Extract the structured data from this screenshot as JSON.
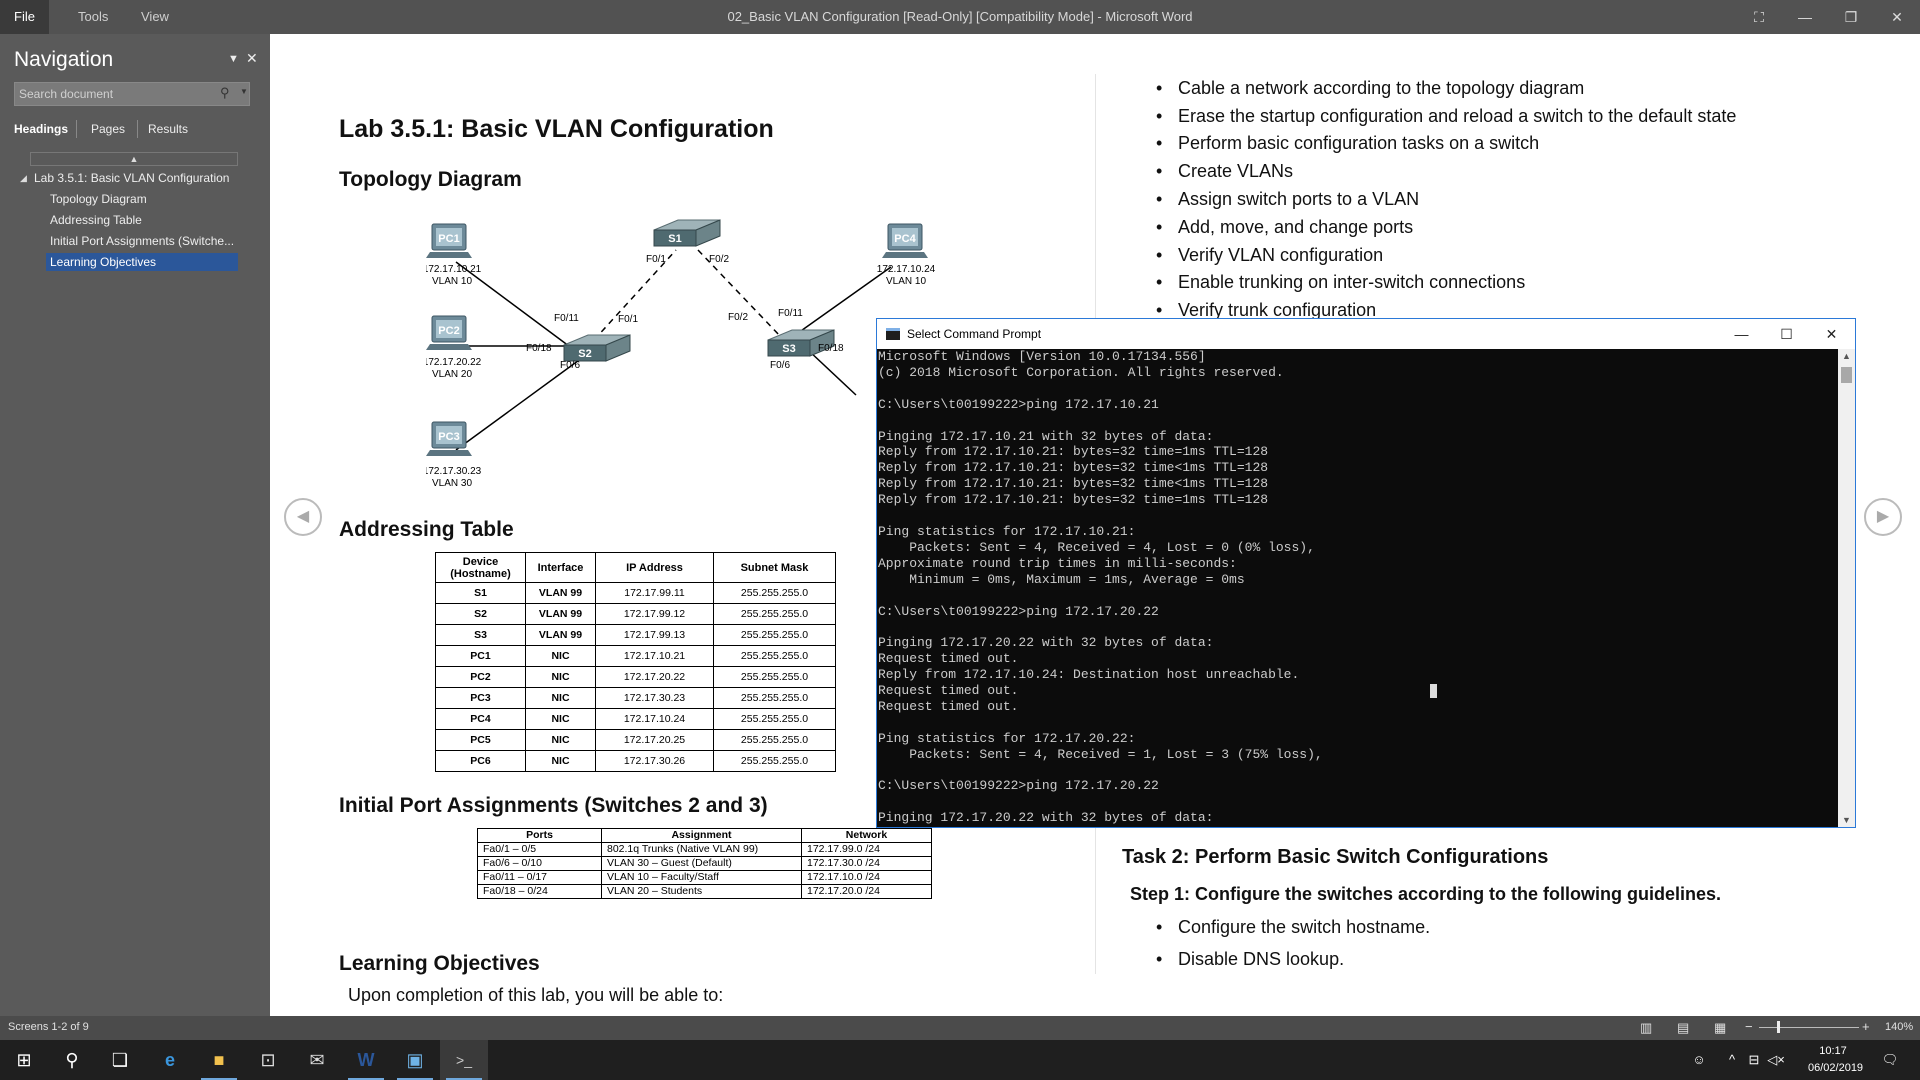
{
  "titlebar": {
    "menus": [
      "File",
      "Tools",
      "View"
    ],
    "title": "02_Basic VLAN Configuration [Read-Only] [Compatibility Mode] - Microsoft Word"
  },
  "nav": {
    "title": "Navigation",
    "search_placeholder": "Search document",
    "tabs": [
      "Headings",
      "Pages",
      "Results"
    ],
    "items": [
      {
        "label": "Lab 3.5.1: Basic VLAN Configuration"
      },
      {
        "label": "Topology Diagram"
      },
      {
        "label": "Addressing Table"
      },
      {
        "label": "Initial Port Assignments (Switche..."
      },
      {
        "label": "Learning Objectives"
      }
    ]
  },
  "doc": {
    "lab_title": "Lab 3.5.1: Basic VLAN Configuration",
    "topology_heading": "Topology Diagram",
    "addressing_heading": "Addressing Table",
    "ports_heading": "Initial Port Assignments (Switches 2 and 3)",
    "objectives_heading": "Learning Objectives",
    "objectives_intro": "Upon completion of this lab, you will be able to:",
    "objectives": [
      "Cable a network according to the topology diagram",
      "Erase the startup configuration and reload a switch to the default state",
      "Perform basic configuration tasks on a switch",
      "Create VLANs",
      "Assign switch ports to a VLAN",
      "Add, move, and change ports",
      "Verify VLAN configuration",
      "Enable trunking on inter-switch connections",
      "Verify trunk configuration"
    ],
    "task2_heading": "Task 2: Perform Basic Switch Configurations",
    "step1_heading": "Step 1: Configure the switches according to the following guidelines.",
    "step1_items": [
      "Configure the switch hostname.",
      "Disable DNS lookup."
    ]
  },
  "topology": {
    "devices": {
      "s1": "S1",
      "s2": "S2",
      "s3": "S3",
      "pc1": "PC1",
      "pc2": "PC2",
      "pc3": "PC3",
      "pc4": "PC4"
    },
    "pc_labels": {
      "pc1_ip": "172.17.10.21",
      "pc1_vlan": "VLAN 10",
      "pc2_ip": "172.17.20.22",
      "pc2_vlan": "VLAN 20",
      "pc3_ip": "172.17.30.23",
      "pc3_vlan": "VLAN 30",
      "pc4_ip": "172.17.10.24",
      "pc4_vlan": "VLAN 10"
    },
    "ports": {
      "s1_f01": "F0/1",
      "s1_f02": "F0/2",
      "s2_f011": "F0/11",
      "s2_f018": "F0/18",
      "s2_f06": "F0/6",
      "s2_f01": "F0/1",
      "s3_f02": "F0/2",
      "s3_f011": "F0/11",
      "s3_f018": "F0/18",
      "s3_f06": "F0/6"
    }
  },
  "addressing_table": {
    "headers": [
      "Device (Hostname)",
      "Interface",
      "IP Address",
      "Subnet Mask"
    ],
    "rows": [
      [
        "S1",
        "VLAN 99",
        "172.17.99.11",
        "255.255.255.0"
      ],
      [
        "S2",
        "VLAN 99",
        "172.17.99.12",
        "255.255.255.0"
      ],
      [
        "S3",
        "VLAN 99",
        "172.17.99.13",
        "255.255.255.0"
      ],
      [
        "PC1",
        "NIC",
        "172.17.10.21",
        "255.255.255.0"
      ],
      [
        "PC2",
        "NIC",
        "172.17.20.22",
        "255.255.255.0"
      ],
      [
        "PC3",
        "NIC",
        "172.17.30.23",
        "255.255.255.0"
      ],
      [
        "PC4",
        "NIC",
        "172.17.10.24",
        "255.255.255.0"
      ],
      [
        "PC5",
        "NIC",
        "172.17.20.25",
        "255.255.255.0"
      ],
      [
        "PC6",
        "NIC",
        "172.17.30.26",
        "255.255.255.0"
      ]
    ]
  },
  "ports_table": {
    "headers": [
      "Ports",
      "Assignment",
      "Network"
    ],
    "rows": [
      [
        "Fa0/1 – 0/5",
        "802.1q Trunks (Native VLAN 99)",
        "172.17.99.0 /24"
      ],
      [
        "Fa0/6 – 0/10",
        "VLAN 30 – Guest (Default)",
        "172.17.30.0 /24"
      ],
      [
        "Fa0/11 – 0/17",
        "VLAN 10 – Faculty/Staff",
        "172.17.10.0 /24"
      ],
      [
        "Fa0/18 – 0/24",
        "VLAN 20 – Students",
        "172.17.20.0 /24"
      ]
    ]
  },
  "cmd": {
    "title": "Select Command Prompt",
    "output": "Microsoft Windows [Version 10.0.17134.556]\n(c) 2018 Microsoft Corporation. All rights reserved.\n\nC:\\Users\\t00199222>ping 172.17.10.21\n\nPinging 172.17.10.21 with 32 bytes of data:\nReply from 172.17.10.21: bytes=32 time=1ms TTL=128\nReply from 172.17.10.21: bytes=32 time<1ms TTL=128\nReply from 172.17.10.21: bytes=32 time<1ms TTL=128\nReply from 172.17.10.21: bytes=32 time=1ms TTL=128\n\nPing statistics for 172.17.10.21:\n    Packets: Sent = 4, Received = 4, Lost = 0 (0% loss),\nApproximate round trip times in milli-seconds:\n    Minimum = 0ms, Maximum = 1ms, Average = 0ms\n\nC:\\Users\\t00199222>ping 172.17.20.22\n\nPinging 172.17.20.22 with 32 bytes of data:\nRequest timed out.\nReply from 172.17.10.24: Destination host unreachable.\nRequest timed out.\nRequest timed out.\n\nPing statistics for 172.17.20.22:\n    Packets: Sent = 4, Received = 1, Lost = 3 (75% loss),\n\nC:\\Users\\t00199222>ping 172.17.20.22\n\nPinging 172.17.20.22 with 32 bytes of data:"
  },
  "status": {
    "screens": "Screens 1-2 of 9",
    "zoom": "140%"
  },
  "taskbar": {
    "time": "10:17",
    "date": "06/02/2019"
  },
  "colors": {
    "titlebar": "#525252",
    "nav_bg": "#5a5a5a",
    "nav_selected": "#2b579a",
    "cmd_bg": "#0c0c0c",
    "taskbar": "#1f1f1f"
  }
}
